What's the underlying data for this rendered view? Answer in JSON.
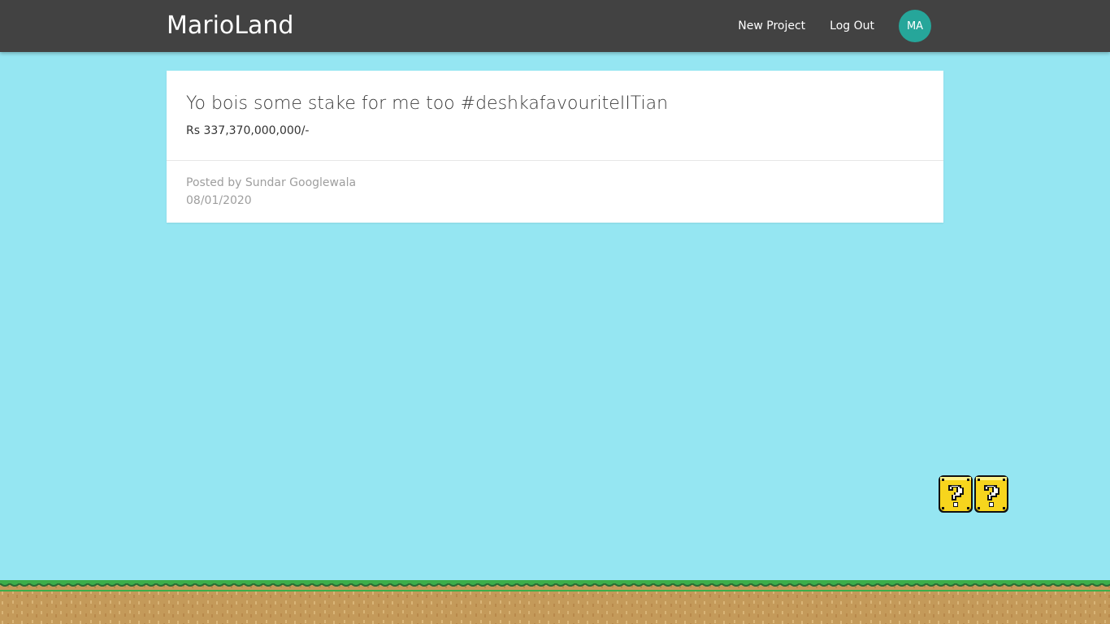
{
  "navbar": {
    "brand": "MarioLand",
    "links": {
      "new_project": "New Project",
      "log_out": "Log Out"
    },
    "avatar_initials": "MA",
    "avatar_color": "#26a69a",
    "background": "#424242"
  },
  "post": {
    "title": "Yo bois some stake for me too #deshkafavouriteIITian",
    "amount": "Rs 337,370,000,000/-",
    "posted_by": "Posted by Sundar Googlewala",
    "date": "08/01/2020"
  },
  "scene": {
    "sky_color": "#95e6f2",
    "question_block_icon": "question-block-icon",
    "ground_icon": "grass-ground"
  }
}
